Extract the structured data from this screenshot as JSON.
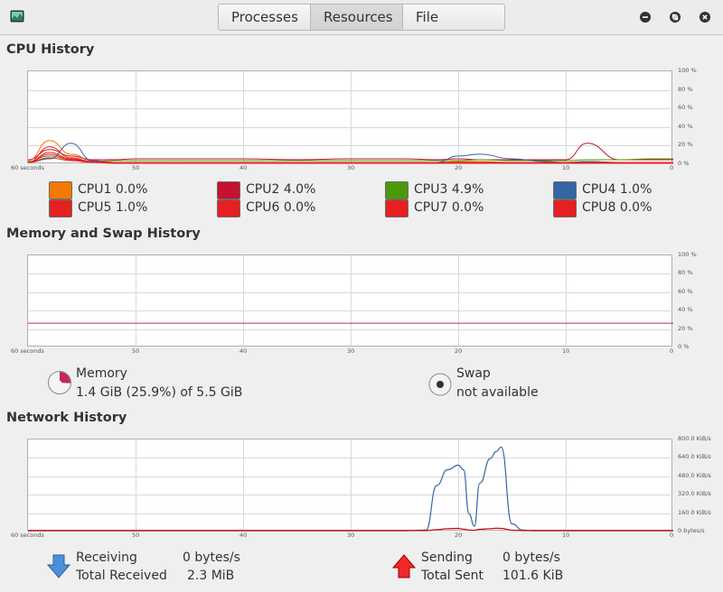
{
  "tabs": [
    {
      "label": "Processes",
      "active": false
    },
    {
      "label": "Resources",
      "active": true
    },
    {
      "label": "File Systems",
      "active": false
    }
  ],
  "window_controls": [
    "minimize-icon",
    "maximize-icon",
    "close-icon"
  ],
  "cpu": {
    "title": "CPU History",
    "y_ticks": [
      "100 %",
      "80 %",
      "60 %",
      "40 %",
      "20 %",
      "0 %"
    ],
    "x_ticks": [
      "60 seconds",
      "50",
      "40",
      "30",
      "20",
      "10",
      "0"
    ],
    "cores": [
      {
        "label": "CPU1",
        "value": "0.0%",
        "color": "#f57900"
      },
      {
        "label": "CPU2",
        "value": "4.0%",
        "color": "#c4122f"
      },
      {
        "label": "CPU3",
        "value": "4.9%",
        "color": "#4e9a06"
      },
      {
        "label": "CPU4",
        "value": "1.0%",
        "color": "#3465a4"
      },
      {
        "label": "CPU5",
        "value": "1.0%",
        "color": "#e62020"
      },
      {
        "label": "CPU6",
        "value": "0.0%",
        "color": "#e62020"
      },
      {
        "label": "CPU7",
        "value": "0.0%",
        "color": "#e62020"
      },
      {
        "label": "CPU8",
        "value": "0.0%",
        "color": "#e62020"
      }
    ]
  },
  "memory": {
    "title": "Memory and Swap History",
    "y_ticks": [
      "100 %",
      "80 %",
      "60 %",
      "40 %",
      "20 %",
      "0 %"
    ],
    "x_ticks": [
      "60 seconds",
      "50",
      "40",
      "30",
      "20",
      "10",
      "0"
    ],
    "memory_label": "Memory",
    "memory_value": "1.4 GiB (25.9%) of 5.5 GiB",
    "memory_fraction": 0.259,
    "memory_color": "#c4275a",
    "swap_label": "Swap",
    "swap_value": "not available"
  },
  "network": {
    "title": "Network History",
    "y_ticks": [
      "800.0 KiB/s",
      "640.0 KiB/s",
      "480.0 KiB/s",
      "320.0 KiB/s",
      "160.0 KiB/s",
      "0 bytes/s"
    ],
    "x_ticks": [
      "60 seconds",
      "50",
      "40",
      "30",
      "20",
      "10",
      "0"
    ],
    "receiving_label": "Receiving",
    "receiving_value": "0 bytes/s",
    "total_received_label": "Total Received",
    "total_received_value": "2.3 MiB",
    "sending_label": "Sending",
    "sending_value": "0 bytes/s",
    "total_sent_label": "Total Sent",
    "total_sent_value": "101.6 KiB",
    "receive_color": "#3465a4",
    "send_color": "#cc0000"
  },
  "chart_data": [
    {
      "type": "line",
      "title": "CPU History",
      "x": [
        60,
        58,
        56,
        54,
        52,
        50,
        45,
        40,
        35,
        30,
        25,
        22,
        20,
        18,
        15,
        12,
        10,
        8,
        5,
        2,
        0
      ],
      "ylim": [
        0,
        100
      ],
      "series": [
        {
          "name": "CPU1",
          "values": [
            3,
            25,
            10,
            3,
            1,
            1,
            1,
            1,
            1,
            1,
            1,
            1,
            2,
            2,
            1,
            1,
            1,
            2,
            1,
            1,
            0
          ]
        },
        {
          "name": "CPU2",
          "values": [
            4,
            15,
            8,
            4,
            4,
            5,
            5,
            5,
            4,
            5,
            5,
            4,
            5,
            4,
            4,
            4,
            4,
            22,
            4,
            4,
            4
          ]
        },
        {
          "name": "CPU3",
          "values": [
            2,
            8,
            4,
            2,
            3,
            3,
            3,
            3,
            3,
            3,
            3,
            3,
            3,
            4,
            3,
            3,
            3,
            4,
            4,
            5,
            5
          ]
        },
        {
          "name": "CPU4",
          "values": [
            1,
            5,
            22,
            3,
            1,
            1,
            1,
            1,
            1,
            1,
            1,
            1,
            8,
            10,
            5,
            2,
            1,
            2,
            1,
            1,
            1
          ]
        },
        {
          "name": "CPU5",
          "values": [
            1,
            10,
            4,
            2,
            1,
            1,
            1,
            1,
            1,
            1,
            1,
            1,
            1,
            1,
            1,
            1,
            1,
            1,
            1,
            1,
            1
          ]
        },
        {
          "name": "CPU6",
          "values": [
            1,
            6,
            3,
            1,
            0,
            0,
            0,
            0,
            0,
            0,
            0,
            0,
            0,
            0,
            0,
            0,
            0,
            0,
            0,
            0,
            0
          ]
        },
        {
          "name": "CPU7",
          "values": [
            1,
            12,
            5,
            2,
            1,
            1,
            0,
            0,
            0,
            0,
            0,
            0,
            0,
            0,
            0,
            0,
            0,
            0,
            0,
            0,
            0
          ]
        },
        {
          "name": "CPU8",
          "values": [
            1,
            18,
            6,
            2,
            1,
            1,
            0,
            0,
            0,
            0,
            0,
            0,
            0,
            0,
            0,
            0,
            0,
            0,
            0,
            0,
            0
          ]
        }
      ]
    },
    {
      "type": "line",
      "title": "Memory and Swap History",
      "x": [
        60,
        0
      ],
      "ylim": [
        0,
        100
      ],
      "series": [
        {
          "name": "Memory",
          "values": [
            25.9,
            25.9
          ]
        }
      ]
    },
    {
      "type": "line",
      "title": "Network History",
      "x": [
        60,
        25,
        23,
        22,
        21,
        20,
        19.5,
        19,
        18.5,
        18,
        17,
        16.5,
        16,
        15,
        14,
        13,
        0
      ],
      "ylim": [
        0,
        800
      ],
      "series": [
        {
          "name": "Receiving",
          "values": [
            0,
            0,
            5,
            400,
            540,
            580,
            540,
            150,
            40,
            420,
            640,
            700,
            740,
            60,
            5,
            0,
            0
          ]
        },
        {
          "name": "Sending",
          "values": [
            0,
            0,
            1,
            8,
            18,
            20,
            14,
            6,
            3,
            12,
            18,
            22,
            20,
            4,
            1,
            0,
            0
          ]
        }
      ]
    }
  ]
}
